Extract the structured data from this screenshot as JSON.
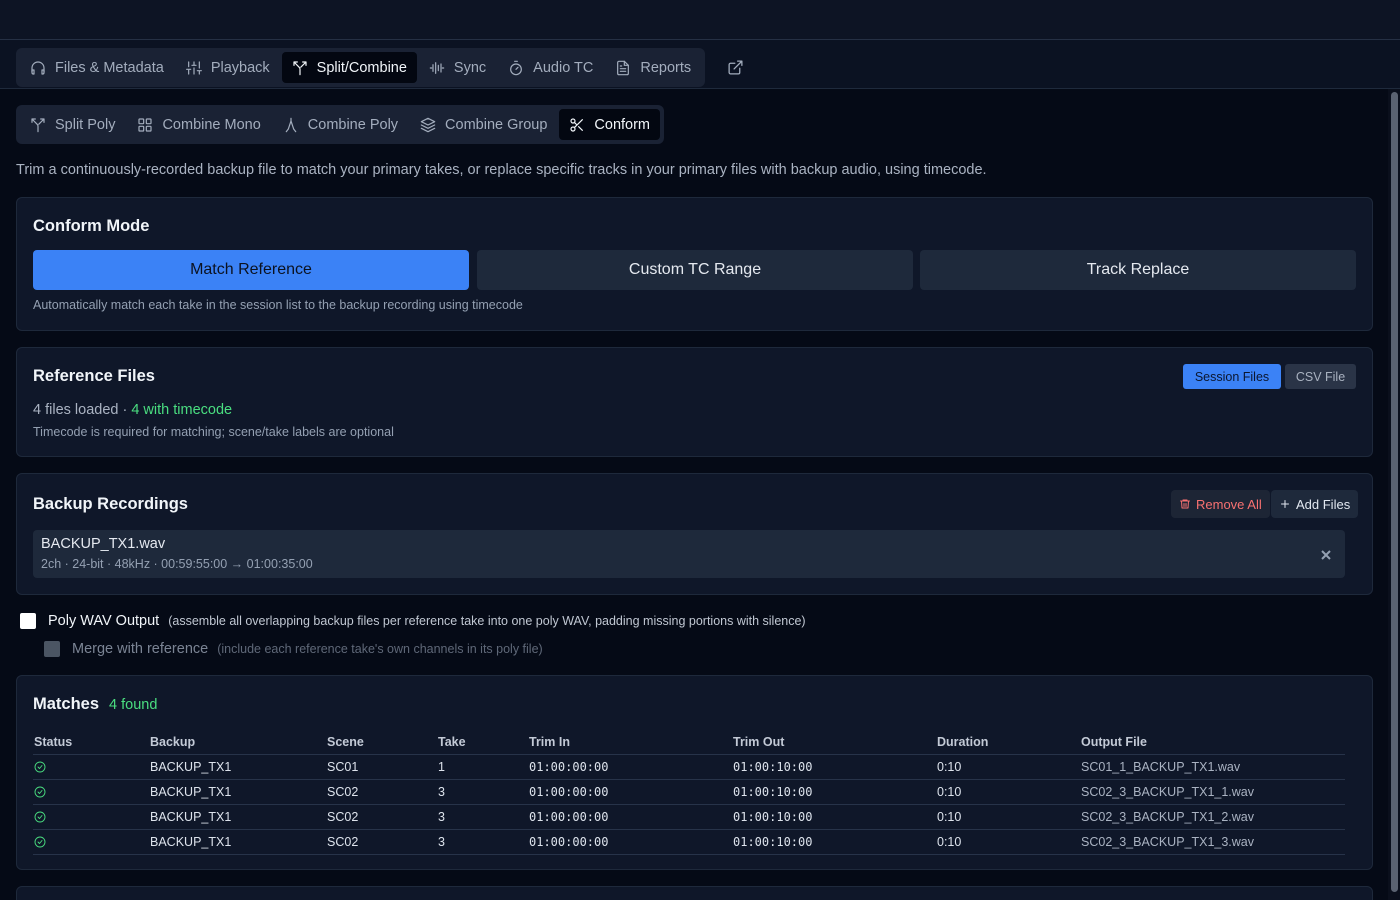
{
  "main_tabs": [
    {
      "label": "Files & Metadata",
      "icon": "headphones-icon"
    },
    {
      "label": "Playback",
      "icon": "sliders-icon"
    },
    {
      "label": "Split/Combine",
      "icon": "split-icon",
      "active": true
    },
    {
      "label": "Sync",
      "icon": "waveform-icon"
    },
    {
      "label": "Audio TC",
      "icon": "timer-icon"
    },
    {
      "label": "Reports",
      "icon": "file-text-icon"
    }
  ],
  "sub_tabs": [
    {
      "label": "Split Poly",
      "icon": "split-icon"
    },
    {
      "label": "Combine Mono",
      "icon": "grid-icon"
    },
    {
      "label": "Combine Poly",
      "icon": "merge-icon"
    },
    {
      "label": "Combine Group",
      "icon": "layers-icon"
    },
    {
      "label": "Conform",
      "icon": "scissors-icon",
      "active": true
    }
  ],
  "description": "Trim a continuously-recorded backup file to match your primary takes, or replace specific tracks in your primary files with backup audio, using timecode.",
  "conform_mode": {
    "title": "Conform Mode",
    "options": [
      "Match Reference",
      "Custom TC Range",
      "Track Replace"
    ],
    "selected": "Match Reference",
    "hint": "Automatically match each take in the session list to the backup recording using timecode"
  },
  "reference_files": {
    "title": "Reference Files",
    "source_options": [
      "Session Files",
      "CSV File"
    ],
    "selected_source": "Session Files",
    "loaded_text": "4 files loaded",
    "separator": " · ",
    "timecode_text": "4 with timecode",
    "hint": "Timecode is required for matching; scene/take labels are optional"
  },
  "backup_recordings": {
    "title": "Backup Recordings",
    "remove_all_label": "Remove All",
    "add_files_label": "Add Files",
    "files": [
      {
        "name": "BACKUP_TX1.wav",
        "meta": "2ch · 24-bit · 48kHz · 00:59:55:00 → 01:00:35:00"
      }
    ]
  },
  "poly_output": {
    "label": "Poly WAV Output",
    "description": "(assemble all overlapping backup files per reference take into one poly WAV, padding missing portions with silence)",
    "checked": false
  },
  "merge_reference": {
    "label": "Merge with reference",
    "description": "(include each reference take's own channels in its poly file)",
    "enabled": false
  },
  "matches": {
    "title": "Matches",
    "count_label": "4 found",
    "columns": [
      "Status",
      "Backup",
      "Scene",
      "Take",
      "Trim In",
      "Trim Out",
      "Duration",
      "Output File"
    ],
    "rows": [
      {
        "status": "ok",
        "backup": "BACKUP_TX1",
        "scene": "SC01",
        "take": "1",
        "trim_in": "01:00:00:00",
        "trim_out": "01:00:10:00",
        "duration": "0:10",
        "output": "SC01_1_BACKUP_TX1.wav"
      },
      {
        "status": "ok",
        "backup": "BACKUP_TX1",
        "scene": "SC02",
        "take": "3",
        "trim_in": "01:00:00:00",
        "trim_out": "01:00:10:00",
        "duration": "0:10",
        "output": "SC02_3_BACKUP_TX1_1.wav"
      },
      {
        "status": "ok",
        "backup": "BACKUP_TX1",
        "scene": "SC02",
        "take": "3",
        "trim_in": "01:00:00:00",
        "trim_out": "01:00:10:00",
        "duration": "0:10",
        "output": "SC02_3_BACKUP_TX1_2.wav"
      },
      {
        "status": "ok",
        "backup": "BACKUP_TX1",
        "scene": "SC02",
        "take": "3",
        "trim_in": "01:00:00:00",
        "trim_out": "01:00:10:00",
        "duration": "0:10",
        "output": "SC02_3_BACKUP_TX1_3.wav"
      }
    ]
  },
  "colors": {
    "accent": "#3b82f6",
    "success": "#4ade80",
    "danger": "#f87171",
    "background": "#050a16",
    "card": "#0f1729"
  }
}
